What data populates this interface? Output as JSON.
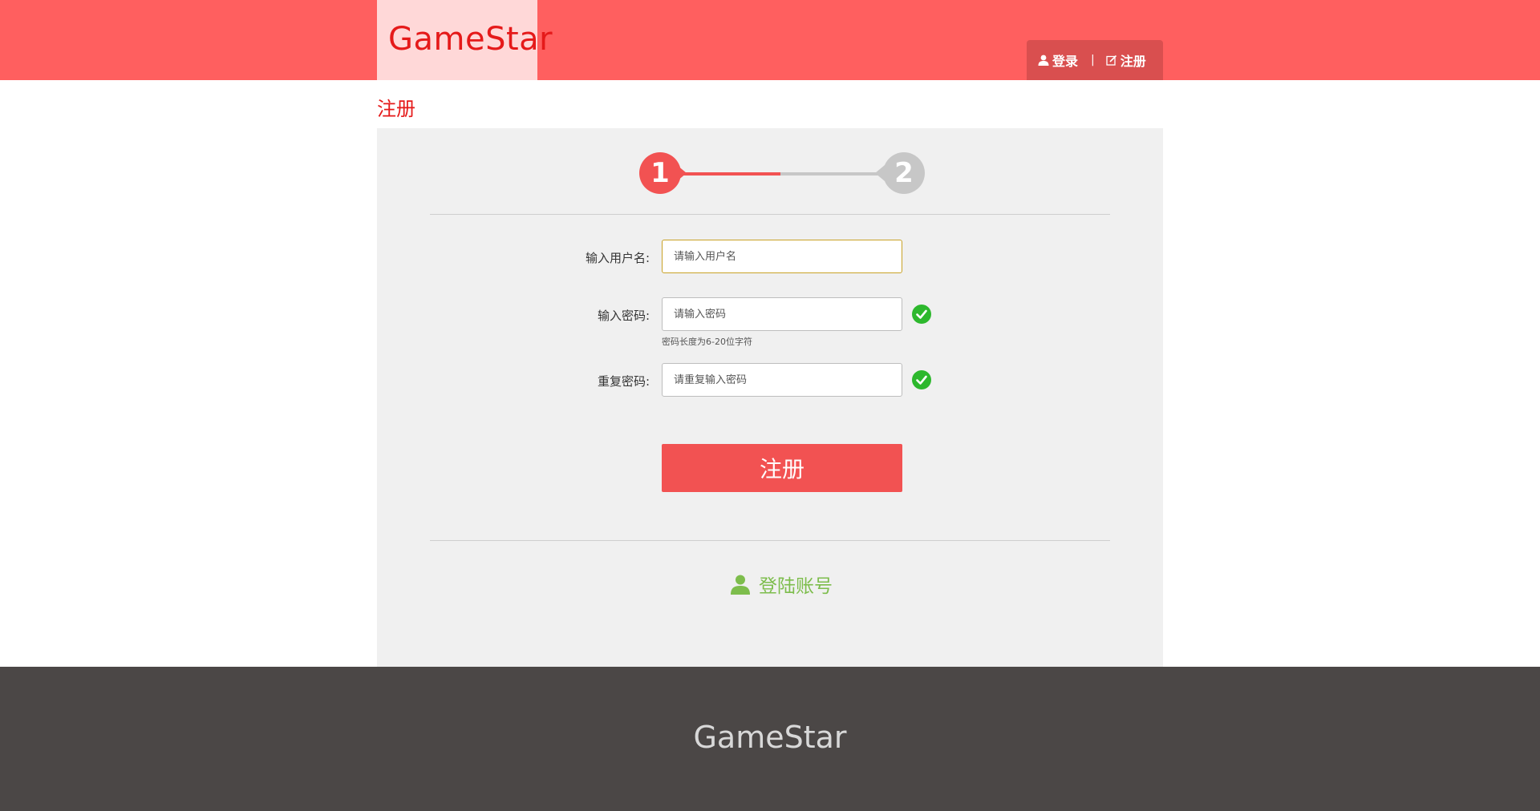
{
  "header": {
    "logo": "GameStar",
    "login_label": "登录",
    "separator": "|",
    "register_label": "注册"
  },
  "page": {
    "title": "注册"
  },
  "steps": {
    "step1": "1",
    "step2": "2",
    "current": 1,
    "progress": 0.5
  },
  "form": {
    "username_label": "输入用户名:",
    "username_placeholder": "请输入用户名",
    "password_label": "输入密码:",
    "password_placeholder": "请输入密码",
    "password_hint": "密码长度为6-20位字符",
    "repeat_label": "重复密码:",
    "repeat_placeholder": "请重复输入密码",
    "submit_label": "注册"
  },
  "login_link": {
    "label": "登陆账号"
  },
  "footer": {
    "brand": "GameStar"
  },
  "colors": {
    "header_bg": "#ff5f5f",
    "accent": "#f25252",
    "logo_red": "#e51a1a",
    "success_green": "#2db82d",
    "link_green": "#7dbd4c",
    "footer_bg": "#4b4746"
  },
  "icons": {
    "login": "user-icon",
    "register": "edit-icon",
    "valid": "check-circle-icon",
    "login_link": "user-icon"
  }
}
